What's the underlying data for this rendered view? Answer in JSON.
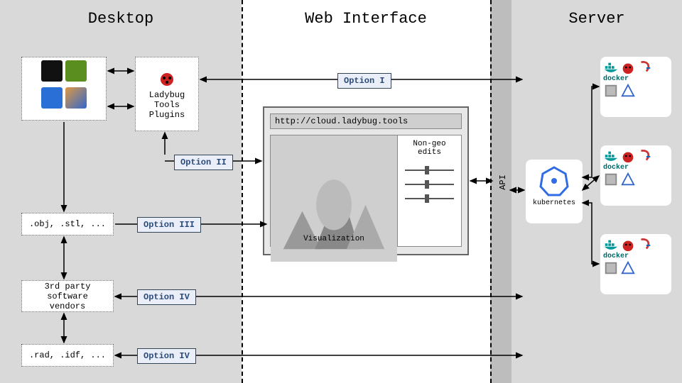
{
  "columns": {
    "desktop": "Desktop",
    "web": "Web Interface",
    "server": "Server"
  },
  "desktop": {
    "ladybug_label": "Ladybug\nTools\nPlugins",
    "files_geo": ".obj, .stl, ...",
    "third_party": "3rd party software\nvendors",
    "files_sim": ".rad, .idf, ...",
    "icons_top": [
      "Rhinoceros",
      "Grasshopper"
    ],
    "icons_bottom": [
      "Revit",
      "Dynamo"
    ]
  },
  "options": {
    "opt1": "Option I",
    "opt2": "Option II",
    "opt3": "Option III",
    "opt4a": "Option IV",
    "opt4b": "Option IV"
  },
  "browser": {
    "url": "http://cloud.ladybug.tools",
    "vis_label": "Visualization",
    "edits_label": "Non-geo\nedits"
  },
  "api_label": "API",
  "server": {
    "kube": "kubernetes",
    "docker": "docker",
    "engines": [
      "EnergyPlus",
      "Radiance",
      "OpenFOAM"
    ]
  }
}
